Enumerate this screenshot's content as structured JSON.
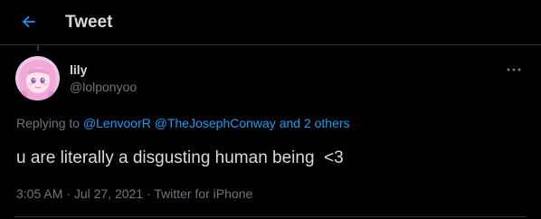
{
  "header": {
    "title": "Tweet",
    "back_icon": "arrow-left-icon"
  },
  "author": {
    "display_name": "lily",
    "handle": "@lolponyoo",
    "avatar_icon": "avatar-image"
  },
  "more_icon": "more-dots-icon",
  "reply": {
    "prefix": "Replying to",
    "mention_1": "@LenvoorR",
    "mention_2": "@TheJosephConway",
    "conjunction": "and",
    "others": "2 others"
  },
  "tweet": {
    "text": "u are literally a disgusting human being  <3"
  },
  "meta": {
    "time": "3:05 AM",
    "separator_1": "·",
    "date": "Jul 27, 2021",
    "separator_2": "·",
    "source": "Twitter for iPhone"
  },
  "colors": {
    "background": "#000000",
    "accent": "#1d9bf0",
    "text_primary": "#d9d9d9",
    "text_secondary": "#6e767d",
    "divider": "#2f3336"
  }
}
